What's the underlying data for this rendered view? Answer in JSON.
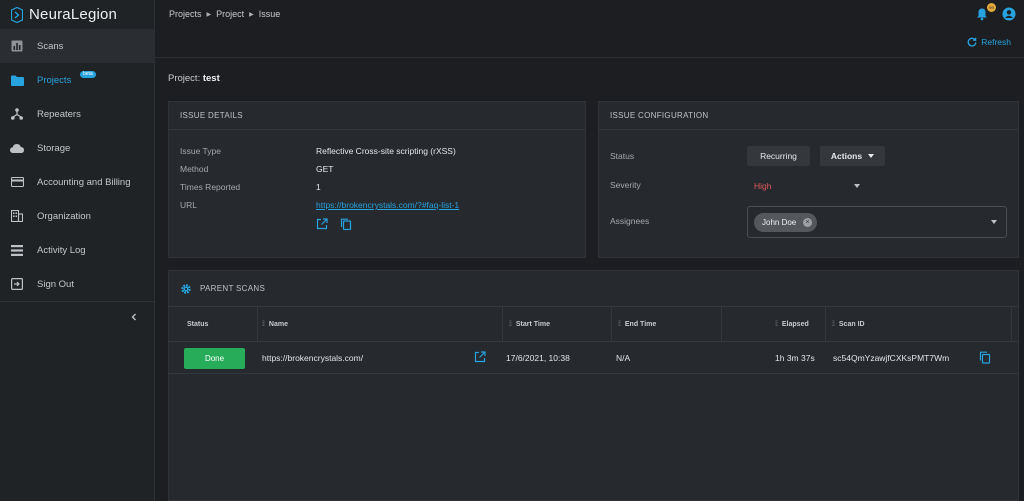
{
  "app": {
    "brand": "NeuraLegion"
  },
  "sidebar": {
    "items": [
      {
        "label": "Scans",
        "icon": "chart-icon"
      },
      {
        "label": "Projects",
        "icon": "folder-icon",
        "badge": "beta"
      },
      {
        "label": "Repeaters",
        "icon": "network-icon"
      },
      {
        "label": "Storage",
        "icon": "cloud-icon"
      },
      {
        "label": "Accounting and Billing",
        "icon": "credit-card-icon"
      },
      {
        "label": "Organization",
        "icon": "building-icon"
      },
      {
        "label": "Activity Log",
        "icon": "list-icon"
      },
      {
        "label": "Sign Out",
        "icon": "sign-out-icon"
      }
    ]
  },
  "breadcrumb": [
    "Projects",
    "Project",
    "Issue"
  ],
  "topbar": {
    "notification_count": "99",
    "refresh_label": "Refresh"
  },
  "project": {
    "prefix": "Project:",
    "name": "test"
  },
  "issue_details": {
    "title": "ISSUE DETAILS",
    "fields": [
      {
        "label": "Issue Type",
        "value": "Reflective Cross-site scripting (rXSS)"
      },
      {
        "label": "Method",
        "value": "GET"
      },
      {
        "label": "Times Reported",
        "value": "1"
      },
      {
        "label": "URL",
        "value": "https://brokencrystals.com/?#faq-list-1"
      }
    ]
  },
  "issue_config": {
    "title": "ISSUE CONFIGURATION",
    "status_label": "Status",
    "status_value": "Recurring",
    "actions_label": "Actions",
    "severity_label": "Severity",
    "severity_value": "High",
    "assignees_label": "Assignees",
    "assignee": "John Doe"
  },
  "parent_scans": {
    "title": "PARENT SCANS",
    "columns": [
      "Status",
      "Name",
      "Start Time",
      "End Time",
      "Elapsed",
      "Scan ID"
    ],
    "rows": [
      {
        "status": "Done",
        "name": "https://brokencrystals.com/",
        "start": "17/6/2021, 10:38",
        "end": "N/A",
        "elapsed": "1h 3m 37s",
        "scan_id": "sc54QmYzawjfCXKsPMT7Wm"
      }
    ]
  },
  "colors": {
    "accent": "#27a3e0",
    "done": "#27ad5a",
    "severity_high": "#e05a5a",
    "badge": "#e5a83a"
  }
}
